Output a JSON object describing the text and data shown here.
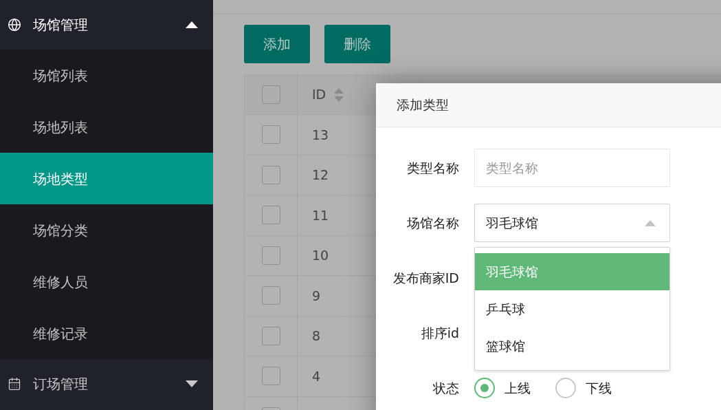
{
  "sidebar": {
    "groups": [
      {
        "label": "场馆管理",
        "expanded": true,
        "items": [
          {
            "label": "场馆列表",
            "selected": false
          },
          {
            "label": "场地列表",
            "selected": false
          },
          {
            "label": "场地类型",
            "selected": true
          },
          {
            "label": "场馆分类",
            "selected": false
          },
          {
            "label": "维修人员",
            "selected": false
          },
          {
            "label": "维修记录",
            "selected": false
          }
        ]
      },
      {
        "label": "订场管理",
        "expanded": false
      }
    ]
  },
  "toolbar": {
    "buttons": [
      "添加",
      "删除"
    ]
  },
  "table": {
    "header_checked": false,
    "columns": [
      {
        "label": "ID",
        "sortable": true
      }
    ],
    "rows": [
      {
        "id": "13",
        "checked": false
      },
      {
        "id": "12",
        "checked": false
      },
      {
        "id": "11",
        "checked": false
      },
      {
        "id": "10",
        "checked": false
      },
      {
        "id": "9",
        "checked": false
      },
      {
        "id": "8",
        "checked": false
      },
      {
        "id": "4",
        "checked": false
      }
    ]
  },
  "modal": {
    "title": "添加类型",
    "fields": [
      {
        "kind": "text",
        "label": "类型名称",
        "placeholder": "类型名称"
      },
      {
        "kind": "select",
        "label": "场馆名称",
        "value": "羽毛球馆",
        "expanded": true,
        "options": [
          {
            "label": "羽毛球馆",
            "selected": true
          },
          {
            "label": "乒乓球",
            "selected": false
          },
          {
            "label": "篮球馆",
            "selected": false
          }
        ]
      },
      {
        "kind": "text",
        "label": "发布商家ID"
      },
      {
        "kind": "text",
        "label": "排序id"
      },
      {
        "kind": "radio",
        "label": "状态",
        "options": [
          {
            "label": "上线",
            "selected": true
          },
          {
            "label": "下线",
            "selected": false
          }
        ]
      }
    ]
  }
}
